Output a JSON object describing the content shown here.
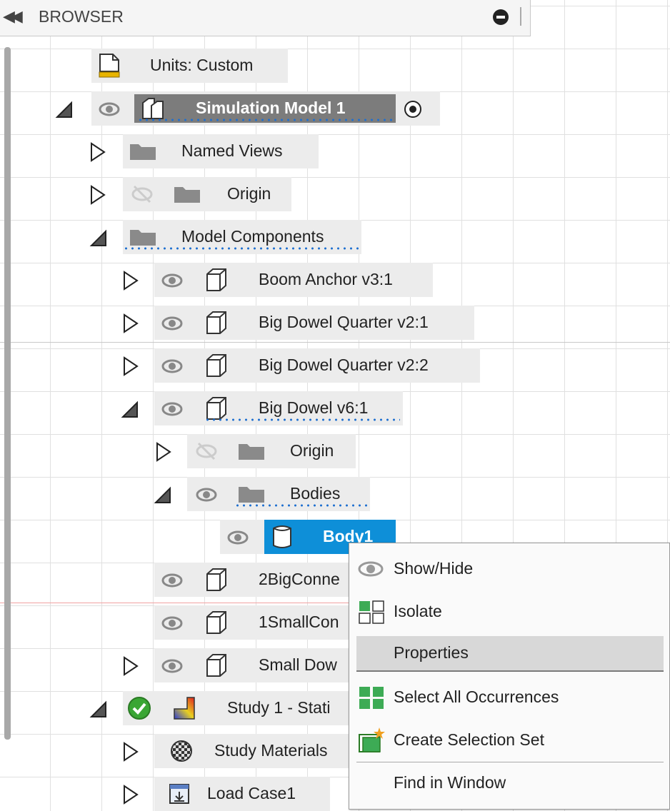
{
  "browser": {
    "title": "BROWSER",
    "collapse_icon": "double-chevron-left-icon",
    "minimize_icon": "minus-circle-icon"
  },
  "tree": {
    "units": "Units: Custom",
    "simulation_model": "Simulation Model 1",
    "named_views": "Named Views",
    "origin": "Origin",
    "model_components": "Model Components",
    "boom_anchor": "Boom Anchor v3:1",
    "big_dowel_quarter_1": "Big Dowel Quarter v2:1",
    "big_dowel_quarter_2": "Big Dowel Quarter v2:2",
    "big_dowel": "Big Dowel v6:1",
    "sub_origin": "Origin",
    "bodies": "Bodies",
    "body1": "Body1",
    "big_connector": "2BigConne",
    "small_connector": "1SmallCon",
    "small_dowel": "Small Dow",
    "study": "Study 1 - Stati",
    "study_materials": "Study Materials",
    "load_case": "Load Case1"
  },
  "context_menu": {
    "items": [
      {
        "label": "Show/Hide",
        "icon": "eye-icon"
      },
      {
        "label": "Isolate",
        "icon": "isolate-icon"
      },
      {
        "label": "Properties",
        "icon": ""
      },
      {
        "label": "Select All Occurrences",
        "icon": "grid-green-icon"
      },
      {
        "label": "Create Selection Set",
        "icon": "selection-set-icon"
      },
      {
        "label": "Find in Window",
        "icon": ""
      }
    ],
    "highlighted": "Properties"
  },
  "colors": {
    "selection": "#0e8fd8",
    "study_ok": "#3aa634",
    "accent_green": "#3dab55"
  }
}
